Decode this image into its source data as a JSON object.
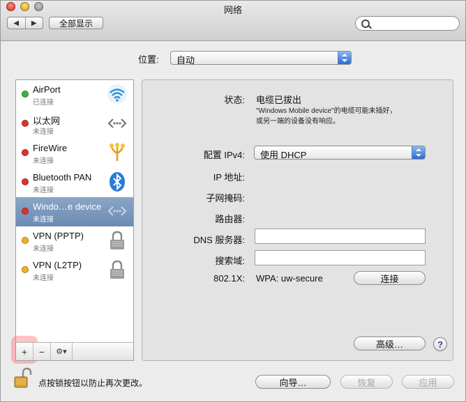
{
  "window": {
    "title": "网络"
  },
  "toolbar": {
    "back_label": "◀",
    "forward_label": "▶",
    "show_all_label": "全部显示",
    "search_placeholder": ""
  },
  "location": {
    "label": "位置:",
    "value": "自动"
  },
  "services": [
    {
      "name": "AirPort",
      "status": "已连接",
      "dot": "#3cb33c",
      "icon": "wifi-icon"
    },
    {
      "name": "以太网",
      "status": "未连接",
      "dot": "#e0322b",
      "icon": "ethernet-icon"
    },
    {
      "name": "FireWire",
      "status": "未连接",
      "dot": "#e0322b",
      "icon": "firewire-icon"
    },
    {
      "name": "Bluetooth PAN",
      "status": "未连接",
      "dot": "#e0322b",
      "icon": "bluetooth-icon"
    },
    {
      "name": "Windo…e device",
      "status": "未连接",
      "dot": "#e0322b",
      "icon": "ethernet-icon",
      "selected": true
    },
    {
      "name": "VPN (PPTP)",
      "status": "未连接",
      "dot": "#f0b020",
      "icon": "lock-icon"
    },
    {
      "name": "VPN (L2TP)",
      "status": "未连接",
      "dot": "#f0b020",
      "icon": "lock-icon"
    }
  ],
  "sidebar_tools": {
    "add": "+",
    "remove": "−",
    "gear": "⚙▾"
  },
  "detail": {
    "status_label": "状态:",
    "status_value": "电缆已拔出",
    "status_note_1": "\"Windows Mobile device\"的电缆可能未插好，",
    "status_note_2": "或另一端的设备没有响应。",
    "configure_label": "配置 IPv4:",
    "configure_value": "使用 DHCP",
    "ip_label": "IP 地址:",
    "subnet_label": "子网掩码:",
    "router_label": "路由器:",
    "dns_label": "DNS 服务器:",
    "dns_value": "",
    "search_domain_label": "搜索域:",
    "search_domain_value": "",
    "dot1x_label": "802.1X:",
    "dot1x_value": "WPA: uw-secure",
    "connect_button": "连接",
    "advanced_button": "高级…",
    "help_button": "?"
  },
  "footer": {
    "lock_text": "点按锁按钮以防止再次更改。",
    "assistant_button": "向导…",
    "revert_button": "恢复",
    "apply_button": "应用"
  }
}
